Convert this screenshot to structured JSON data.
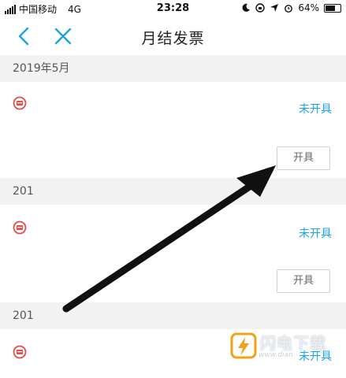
{
  "status_bar": {
    "carrier": "中国移动",
    "network": "4G",
    "time": "23:28",
    "battery": "64%",
    "battery_level": 0.64,
    "icons": [
      "moon-icon",
      "rotation-lock-icon",
      "location-icon",
      "alarm-icon",
      "battery-icon"
    ]
  },
  "nav": {
    "title": "月结发票",
    "icons": [
      "back-icon",
      "close-icon"
    ]
  },
  "sections": [
    {
      "month": "2019年5月",
      "status": "未开具",
      "button": "开具"
    },
    {
      "month": "201",
      "status": "未开具",
      "button": "开具"
    },
    {
      "month": "201",
      "status": "未开具"
    }
  ],
  "watermark": {
    "text": "闪电下载",
    "url": "www.dian"
  },
  "colors": {
    "accent": "#1aa3e8",
    "icon_red": "#e84a4a",
    "section_bg": "#f2f2f2"
  }
}
